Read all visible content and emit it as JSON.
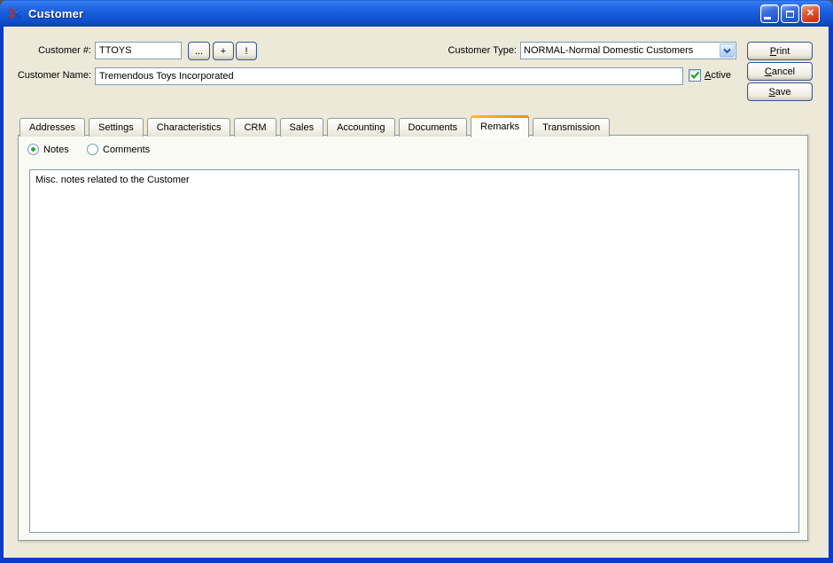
{
  "window": {
    "title": "Customer"
  },
  "icons": {
    "app": "x-logo",
    "minimize": "css-bar",
    "maximize": "css-square",
    "close": "✕",
    "dropdown_arrow": "chevron-down"
  },
  "header": {
    "customer_number": {
      "label": "Customer #:",
      "value": "TTOYS"
    },
    "lookup_button": "...",
    "add_button": "+",
    "info_button": "!",
    "customer_type": {
      "label": "Customer Type:",
      "value": "NORMAL-Normal Domestic Customers"
    },
    "customer_name": {
      "label": "Customer Name:",
      "value": "Tremendous Toys Incorporated"
    },
    "active": {
      "label": "Active",
      "checked": true
    }
  },
  "actions": {
    "print": "Print",
    "cancel": "Cancel",
    "save": "Save"
  },
  "tabs": {
    "active": "Remarks",
    "items": [
      "Addresses",
      "Settings",
      "Characteristics",
      "CRM",
      "Sales",
      "Accounting",
      "Documents",
      "Remarks",
      "Transmission"
    ]
  },
  "remarks_tab": {
    "notes": {
      "label": "Notes",
      "selected": true
    },
    "comments": {
      "label": "Comments",
      "selected": false
    },
    "notes_text": "Misc. notes related to the Customer"
  },
  "colors": {
    "titlebar_blue": "#1A5EDC",
    "window_border": "#0A3CC8",
    "client_bg": "#ECE9D8",
    "active_tab_accent": "#F59D1E",
    "check_green": "#21A121",
    "radio_green": "#3BA53B",
    "field_border": "#7F9DB9"
  }
}
